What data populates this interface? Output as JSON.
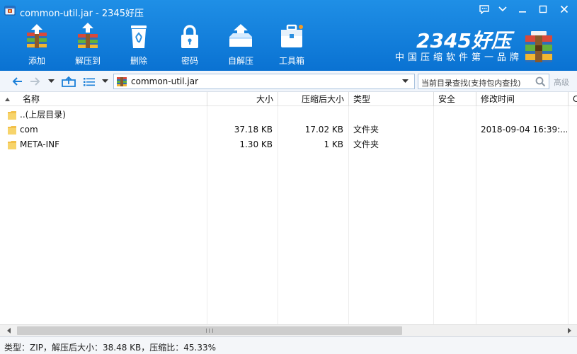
{
  "window": {
    "title": "common-util.jar - 2345好压"
  },
  "toolbar": {
    "items": [
      {
        "label": "添加",
        "icon": "add-archive-icon"
      },
      {
        "label": "解压到",
        "icon": "extract-to-icon"
      },
      {
        "label": "删除",
        "icon": "recycle-bin-icon"
      },
      {
        "label": "密码",
        "icon": "lock-icon"
      },
      {
        "label": "自解压",
        "icon": "self-extract-icon"
      },
      {
        "label": "工具箱",
        "icon": "toolbox-icon"
      }
    ]
  },
  "brand": {
    "name": "2345好压",
    "slogan": "中国压缩软件第一品牌"
  },
  "address": {
    "path": "common-util.jar",
    "search_placeholder": "当前目录查找(支持包内查找)",
    "advanced_label": "高级"
  },
  "columns": [
    "名称",
    "大小",
    "压缩后大小",
    "类型",
    "安全",
    "修改时间",
    "C"
  ],
  "files": [
    {
      "name": "..(上层目录)",
      "size": "",
      "packed": "",
      "type": "",
      "security": "",
      "modified": ""
    },
    {
      "name": "com",
      "size": "37.18 KB",
      "packed": "17.02 KB",
      "type": "文件夹",
      "security": "",
      "modified": "2018-09-04 16:39:..."
    },
    {
      "name": "META-INF",
      "size": "1.30 KB",
      "packed": "1 KB",
      "type": "文件夹",
      "security": "",
      "modified": ""
    }
  ],
  "status": {
    "text": "类型：ZIP，解压后大小：38.48 KB，压缩比：45.33%"
  },
  "colors": {
    "toolbar_top": "#1f8fe6",
    "toolbar_bottom": "#0a72d2",
    "folder": "#f2c04a",
    "accent": "#1a7fd8"
  }
}
